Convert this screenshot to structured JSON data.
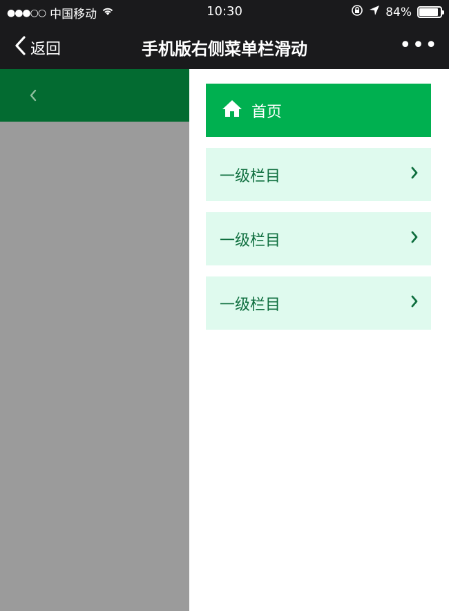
{
  "status_bar": {
    "signal": "●●●○○",
    "carrier": "中国移动",
    "wifi_icon": "wifi-icon",
    "time": "10:30",
    "lock_icon": "rotation-lock-icon",
    "location_icon": "location-arrow-icon",
    "battery": "84%",
    "battery_level": 0.84
  },
  "nav": {
    "back_label": "返回",
    "title": "手机版右侧菜单栏滑动",
    "more_label": "•••"
  },
  "menu": {
    "home_label": "首页",
    "items": [
      {
        "label": "一级栏目"
      },
      {
        "label": "一级栏目"
      },
      {
        "label": "一级栏目"
      }
    ]
  },
  "colors": {
    "bar_dark": "#1a1a1c",
    "left_header": "#036b31",
    "overlay_gray": "#9b9b9b",
    "home_green": "#00b050",
    "item_bg": "#dffaee",
    "item_text": "#0e6e3e"
  }
}
